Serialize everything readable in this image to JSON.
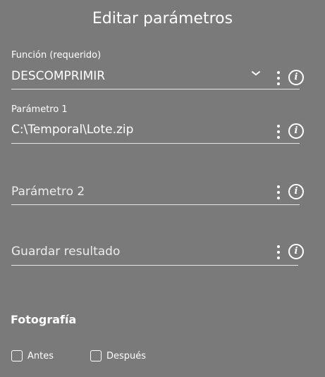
{
  "header": {
    "title": "Editar parámetros"
  },
  "fields": {
    "function": {
      "label": "Función (requerido)",
      "value": "DESCOMPRIMIR",
      "info_glyph": "i"
    },
    "param1": {
      "label": "Parámetro 1",
      "value": "C:\\Temporal\\Lote.zip",
      "info_glyph": "i"
    },
    "param2": {
      "placeholder": "Parámetro 2",
      "info_glyph": "i"
    },
    "save_result": {
      "placeholder": "Guardar resultado",
      "info_glyph": "i"
    }
  },
  "photo": {
    "title": "Fotografía",
    "options": [
      {
        "label": "Antes",
        "checked": false
      },
      {
        "label": "Después",
        "checked": false
      }
    ]
  },
  "icons": {
    "dropdown": "chevron-down-icon",
    "menu": "kebab-menu-icon",
    "info": "info-icon",
    "checkbox": "checkbox-icon"
  },
  "colors": {
    "background": "#7a7a7a",
    "text": "#ffffff",
    "underline": "#e6e6e6"
  }
}
